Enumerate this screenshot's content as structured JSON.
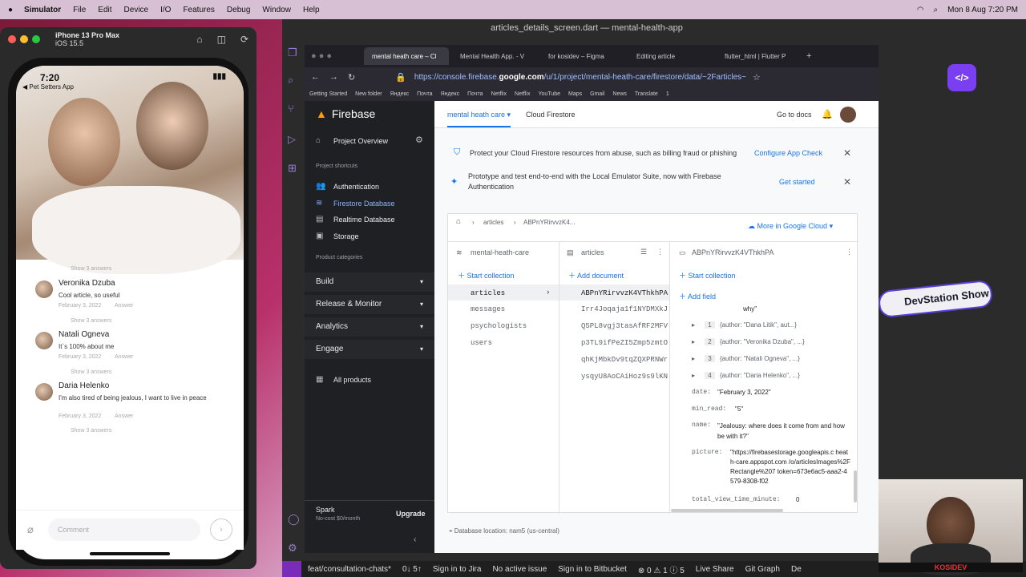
{
  "menubar": {
    "app": "Simulator",
    "items": [
      "File",
      "Edit",
      "Device",
      "I/O",
      "Features",
      "Debug",
      "Window",
      "Help"
    ],
    "clock": "Mon 8 Aug 7:20 PM"
  },
  "simulator": {
    "device": "iPhone 13 Pro Max",
    "os": "iOS 15.5"
  },
  "phone": {
    "time": "7:20",
    "back_app": "◀ Pet Setters App",
    "comment_placeholder": "Comment",
    "comments": [
      {
        "show": "Show 3 answers"
      },
      {
        "name": "Veronika Dzuba",
        "text": "Cool article, so useful",
        "date": "February 3, 2022",
        "answer": "Answer",
        "show": "Show 3 answers"
      },
      {
        "name": "Natali Ogneva",
        "text": "It`s 100% about me",
        "date": "February 3, 2022",
        "answer": "Answer",
        "show": "Show 3 answers"
      },
      {
        "name": "Daria Helenko",
        "text": "I'm also tired of being jealous, I want to live in peace",
        "date": "February 3, 2022",
        "answer": "Answer",
        "show": "Show 3 answers"
      }
    ]
  },
  "ide": {
    "title": "articles_details_screen.dart — mental-health-app",
    "status": [
      "feat/consultation-chats*",
      "0↓ 5↑",
      "Sign in to Jira",
      "No active issue",
      "Sign in to Bitbucket",
      "⊗ 0 ⚠ 1 ⓘ 5",
      "Live Share",
      "Git Graph",
      "De"
    ]
  },
  "browser": {
    "tabs": [
      "mental heath care – Cl",
      "Mental Health App. - V",
      "for kosidev – Figma",
      "Editing article",
      "flutter_html | Flutter P"
    ],
    "url_prefix": "https://console.firebase.",
    "url_host": "google.com",
    "url_rest": "/u/1/project/mental-heath-care/firestore/data/~2Farticles~",
    "bookmarks": [
      "Getting Started",
      "New folder",
      "Яндекс",
      "Почта",
      "Яндекс",
      "Почта",
      "Netflix",
      "Netflix",
      "YouTube",
      "Maps",
      "Gmail",
      "News",
      "Translate",
      "1"
    ]
  },
  "firebase": {
    "brand": "Firebase",
    "project_overview": "Project Overview",
    "shortcuts_label": "Project shortcuts",
    "shortcuts": [
      "Authentication",
      "Firestore Database",
      "Realtime Database",
      "Storage"
    ],
    "categories_label": "Product categories",
    "categories": [
      "Build",
      "Release & Monitor",
      "Analytics",
      "Engage"
    ],
    "all_products": "All products",
    "plan": "Spark",
    "plan_sub": "No-cost $0/month",
    "upgrade": "Upgrade",
    "project": "mental heath care",
    "service": "Cloud Firestore",
    "docs": "Go to docs",
    "banner1": "Protect your Cloud Firestore resources from abuse, such as billing fraud or phishing",
    "banner1_link": "Configure App Check",
    "banner2": "Prototype and test end-to-end with the Local Emulator Suite, now with Firebase Authentication",
    "banner2_link": "Get started",
    "crumb_col": "articles",
    "crumb_doc": "ABPnYRirvvzK4...",
    "more_cloud": "More in Google Cloud",
    "col1_title": "mental-heath-care",
    "col2_title": "articles",
    "col3_title": "ABPnYRirvvzK4VThkhPA",
    "start_collection": "Start collection",
    "add_document": "Add document",
    "add_field": "Add field",
    "collections": [
      "articles",
      "messages",
      "psychologists",
      "users"
    ],
    "documents": [
      "ABPnYRirvvzK4VThkhPA",
      "Irr4Joqaja1f1NYDMXkJ",
      "Q5PL8vgj3tasAfRF2MFV",
      "p3TL9ifPeZI5Zmp5zmtO",
      "qhKjMbkDv9tqZQXPRNWr",
      "ysqyU8AoCAiHoz9s9lKN"
    ],
    "field_why": "why\"",
    "answers": [
      {
        "idx": "1",
        "val": "{author: \"Dana Litik\", aut...}"
      },
      {
        "idx": "2",
        "val": "{author: \"Veronika Dzuba\", ...}"
      },
      {
        "idx": "3",
        "val": "{author: \"Natali Ogneva\", ...}"
      },
      {
        "idx": "4",
        "val": "{author: \"Daria Helenko\", ...}"
      }
    ],
    "date_key": "date:",
    "date_val": "\"February 3, 2022\"",
    "minread_key": "min_read:",
    "minread_val": "\"5\"",
    "name_key": "name:",
    "name_val": "\"Jealousy: where does it come from and how be with it?\"",
    "picture_key": "picture:",
    "picture_val": "\"https://firebasestorage.googleapis.c heath-care.appspot.com /o/articlesImages%2FRectangle%207 token=673e6ac5-aaa2-4579-8308-f02",
    "tvt_key": "total_view_time_minute:",
    "tvt_val": "0",
    "db_location": "Database location: nam5 (us-central)"
  },
  "overlay": {
    "devshow": "DevStation Show",
    "kosidev": "KOSIDEV"
  }
}
